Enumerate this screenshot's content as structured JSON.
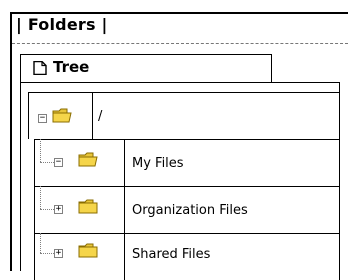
{
  "panel": {
    "title": "| Folders |"
  },
  "tab": {
    "label": "Tree",
    "icon": "page-icon"
  },
  "tree": {
    "root": {
      "label": "/",
      "expander": "−",
      "icon": "open-folder-icon"
    },
    "children": [
      {
        "label": "My Files",
        "expander": "−",
        "icon": "open-folder-icon"
      },
      {
        "label": "Organization Files",
        "expander": "+",
        "icon": "folder-icon"
      },
      {
        "label": "Shared Files",
        "expander": "+",
        "icon": "folder-icon"
      }
    ]
  },
  "colors": {
    "folder_fill": "#f5d54a",
    "folder_edge": "#b38f00",
    "line": "#000000"
  }
}
